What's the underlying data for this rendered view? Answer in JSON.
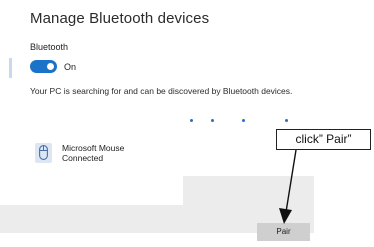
{
  "page": {
    "title": "Manage Bluetooth devices"
  },
  "bluetooth": {
    "label": "Bluetooth",
    "toggle_state": "On",
    "enabled": true,
    "status_text": "Your PC is searching for and can be discovered by Bluetooth devices."
  },
  "device": {
    "icon": "mouse-icon",
    "name": "Microsoft Mouse",
    "status": "Connected"
  },
  "actions": {
    "pair_label": "Pair"
  },
  "annotation": {
    "callout_text": "click” Pair”"
  },
  "colors": {
    "accent": "#1a73c8",
    "selection": "#ececec",
    "button": "#cfcfcf"
  }
}
